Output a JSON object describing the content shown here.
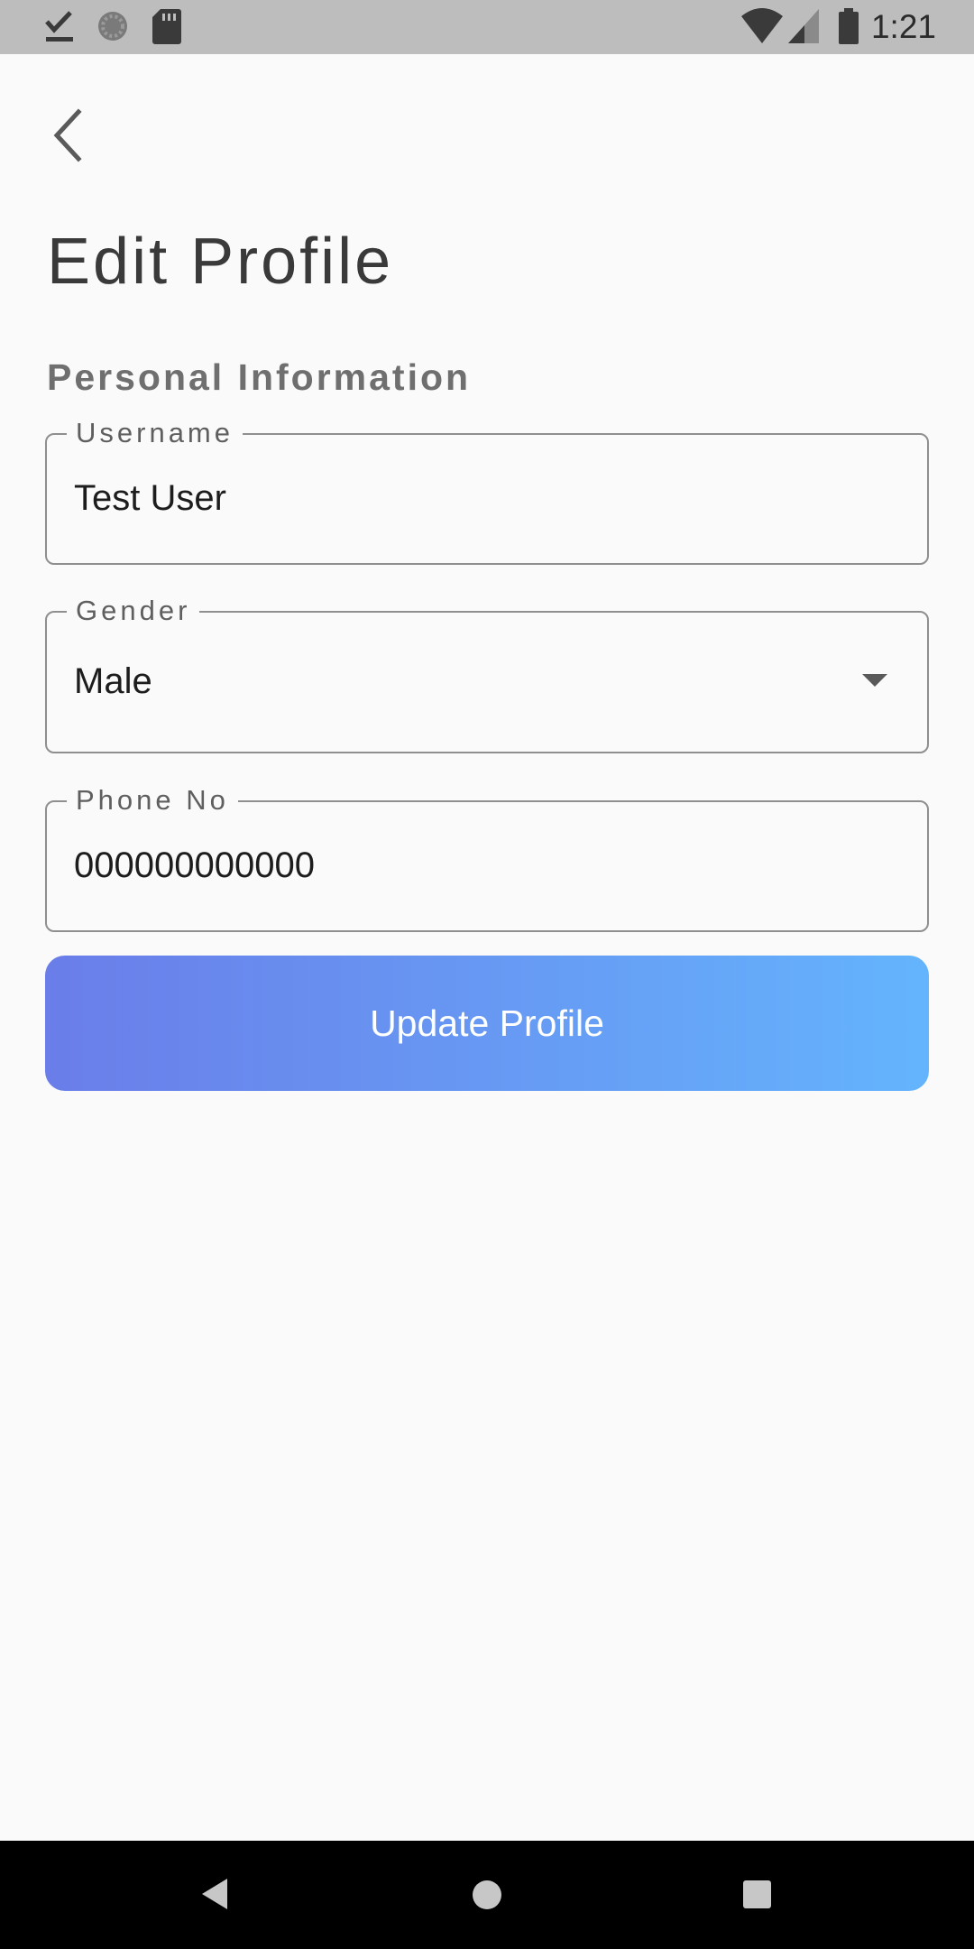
{
  "status_bar": {
    "time": "1:21",
    "icons": [
      "download-done-icon",
      "sync-icon",
      "sd-card-icon",
      "wifi-icon",
      "cell-signal-icon",
      "battery-icon"
    ]
  },
  "header": {
    "back_icon": "chevron-left-icon",
    "title": "Edit Profile"
  },
  "form": {
    "section_title": "Personal Information",
    "username": {
      "label": "Username",
      "value": "Test User"
    },
    "gender": {
      "label": "Gender",
      "value": "Male"
    },
    "phone": {
      "label": "Phone No",
      "value": "000000000000"
    },
    "submit_label": "Update Profile"
  },
  "colors": {
    "button_gradient_start": "#6a7de9",
    "button_gradient_end": "#64b4fd",
    "status_bar": "#bdbdbd",
    "background": "#fafafa"
  },
  "nav_bar": {
    "icons": [
      "back-triangle-icon",
      "home-circle-icon",
      "recents-square-icon"
    ]
  }
}
